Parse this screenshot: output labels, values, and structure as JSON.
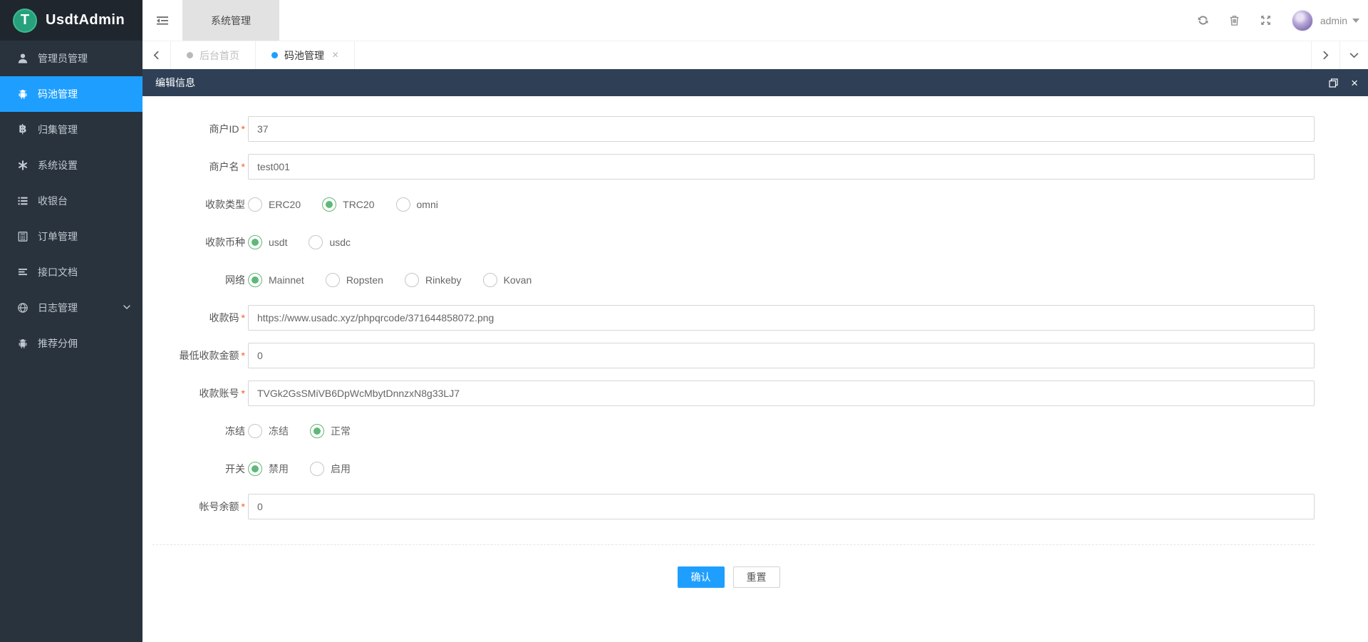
{
  "app": {
    "title": "UsdtAdmin",
    "logo_letter": "T"
  },
  "colors": {
    "accent": "#1e9fff",
    "green": "#5fb878",
    "danger": "#ff5722",
    "sidebar_bg": "#28333e",
    "panel_header_bg": "#2f4056",
    "tether_green": "#26a17b"
  },
  "sidebar": {
    "items": [
      {
        "label": "管理员管理",
        "icon": "user-icon",
        "active": false
      },
      {
        "label": "码池管理",
        "icon": "android-icon",
        "active": true
      },
      {
        "label": "归集管理",
        "icon": "bitcoin-icon",
        "active": false
      },
      {
        "label": "系统设置",
        "icon": "asterisk-icon",
        "active": false
      },
      {
        "label": "收银台",
        "icon": "list-icon",
        "active": false
      },
      {
        "label": "订单管理",
        "icon": "calculator-icon",
        "active": false
      },
      {
        "label": "接口文档",
        "icon": "align-left-icon",
        "active": false
      },
      {
        "label": "日志管理",
        "icon": "web-icon",
        "active": false,
        "has_submenu": true
      },
      {
        "label": "推荐分佣",
        "icon": "android-icon",
        "active": false
      }
    ],
    "bitcoin_glyph": "฿",
    "asterisk_glyph": "*"
  },
  "topbar": {
    "nav_tab": "系统管理",
    "username": "admin"
  },
  "tabbar": {
    "tabs": [
      {
        "label": "后台首页",
        "active": false,
        "closable": false
      },
      {
        "label": "码池管理",
        "active": true,
        "closable": true,
        "close_glyph": "×"
      }
    ]
  },
  "panel": {
    "title": "编辑信息",
    "close_glyph": "×"
  },
  "form": {
    "required_mark": "*",
    "rows": [
      {
        "type": "input",
        "label": "商户ID",
        "required": true,
        "value": "37"
      },
      {
        "type": "input",
        "label": "商户名",
        "required": true,
        "value": "test001"
      },
      {
        "type": "radio",
        "label": "收款类型",
        "required": false,
        "options": [
          {
            "label": "ERC20",
            "checked": false
          },
          {
            "label": "TRC20",
            "checked": true
          },
          {
            "label": "omni",
            "checked": false
          }
        ]
      },
      {
        "type": "radio",
        "label": "收款币种",
        "required": false,
        "options": [
          {
            "label": "usdt",
            "checked": true
          },
          {
            "label": "usdc",
            "checked": false
          }
        ]
      },
      {
        "type": "radio",
        "label": "网络",
        "required": false,
        "options": [
          {
            "label": "Mainnet",
            "checked": true
          },
          {
            "label": "Ropsten",
            "checked": false
          },
          {
            "label": "Rinkeby",
            "checked": false
          },
          {
            "label": "Kovan",
            "checked": false
          }
        ]
      },
      {
        "type": "input",
        "label": "收款码",
        "required": true,
        "value": "https://www.usadc.xyz/phpqrcode/371644858072.png"
      },
      {
        "type": "input",
        "label": "最低收款金额",
        "required": true,
        "value": "0"
      },
      {
        "type": "input",
        "label": "收款账号",
        "required": true,
        "value": "TVGk2GsSMiVB6DpWcMbytDnnzxN8g33LJ7"
      },
      {
        "type": "radio",
        "label": "冻结",
        "required": false,
        "options": [
          {
            "label": "冻结",
            "checked": false
          },
          {
            "label": "正常",
            "checked": true
          }
        ]
      },
      {
        "type": "radio",
        "label": "开关",
        "required": false,
        "options": [
          {
            "label": "禁用",
            "checked": true
          },
          {
            "label": "启用",
            "checked": false
          }
        ]
      },
      {
        "type": "input",
        "label": "帐号余额",
        "required": true,
        "value": "0"
      }
    ],
    "confirm_label": "确认",
    "reset_label": "重置"
  }
}
